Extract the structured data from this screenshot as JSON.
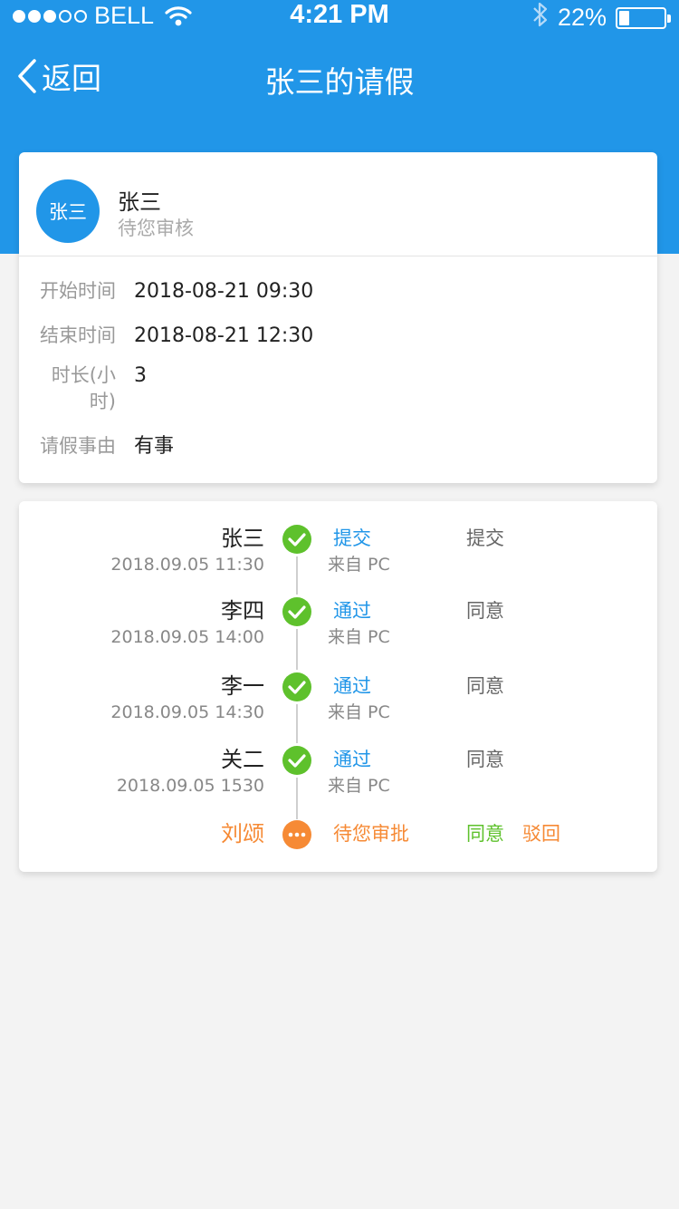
{
  "status_bar": {
    "carrier": "BELL",
    "time": "4:21 PM",
    "battery_percent": "22%",
    "battery_level": 0.22
  },
  "nav": {
    "back_label": "返回",
    "title": "张三的请假"
  },
  "applicant": {
    "avatar_text": "张三",
    "name": "张三",
    "status": "待您审核"
  },
  "details": [
    {
      "label": "开始时间",
      "value": "2018-08-21 09:30"
    },
    {
      "label": "结束时间",
      "value": "2018-08-21 12:30"
    },
    {
      "label_line1": "时长(小",
      "label_line2": "时)",
      "value": "3"
    },
    {
      "label": "请假事由",
      "value": "有事"
    }
  ],
  "timeline": [
    {
      "name": "张三",
      "time": "2018.09.05 11:30",
      "action": "提交",
      "source": "来自 PC",
      "result": "提交",
      "icon": "check-icon"
    },
    {
      "name": "李四",
      "time": "2018.09.05 14:00",
      "action": "通过",
      "source": "来自 PC",
      "result": "同意",
      "icon": "check-icon"
    },
    {
      "name": "李一",
      "time": "2018.09.05 14:30",
      "action": "通过",
      "source": "来自 PC",
      "result": "同意",
      "icon": "check-icon"
    },
    {
      "name": "关二",
      "time": "2018.09.05 1530",
      "action": "通过",
      "source": "来自 PC",
      "result": "同意",
      "icon": "check-icon"
    }
  ],
  "pending": {
    "name": "刘颂",
    "action": "待您审批",
    "agree_label": "同意",
    "reject_label": "驳回",
    "icon": "more-dots-icon"
  },
  "colors": {
    "primary": "#2196e8",
    "success": "#5ec12c",
    "warning": "#f68a35",
    "background": "#f3f3f3"
  }
}
